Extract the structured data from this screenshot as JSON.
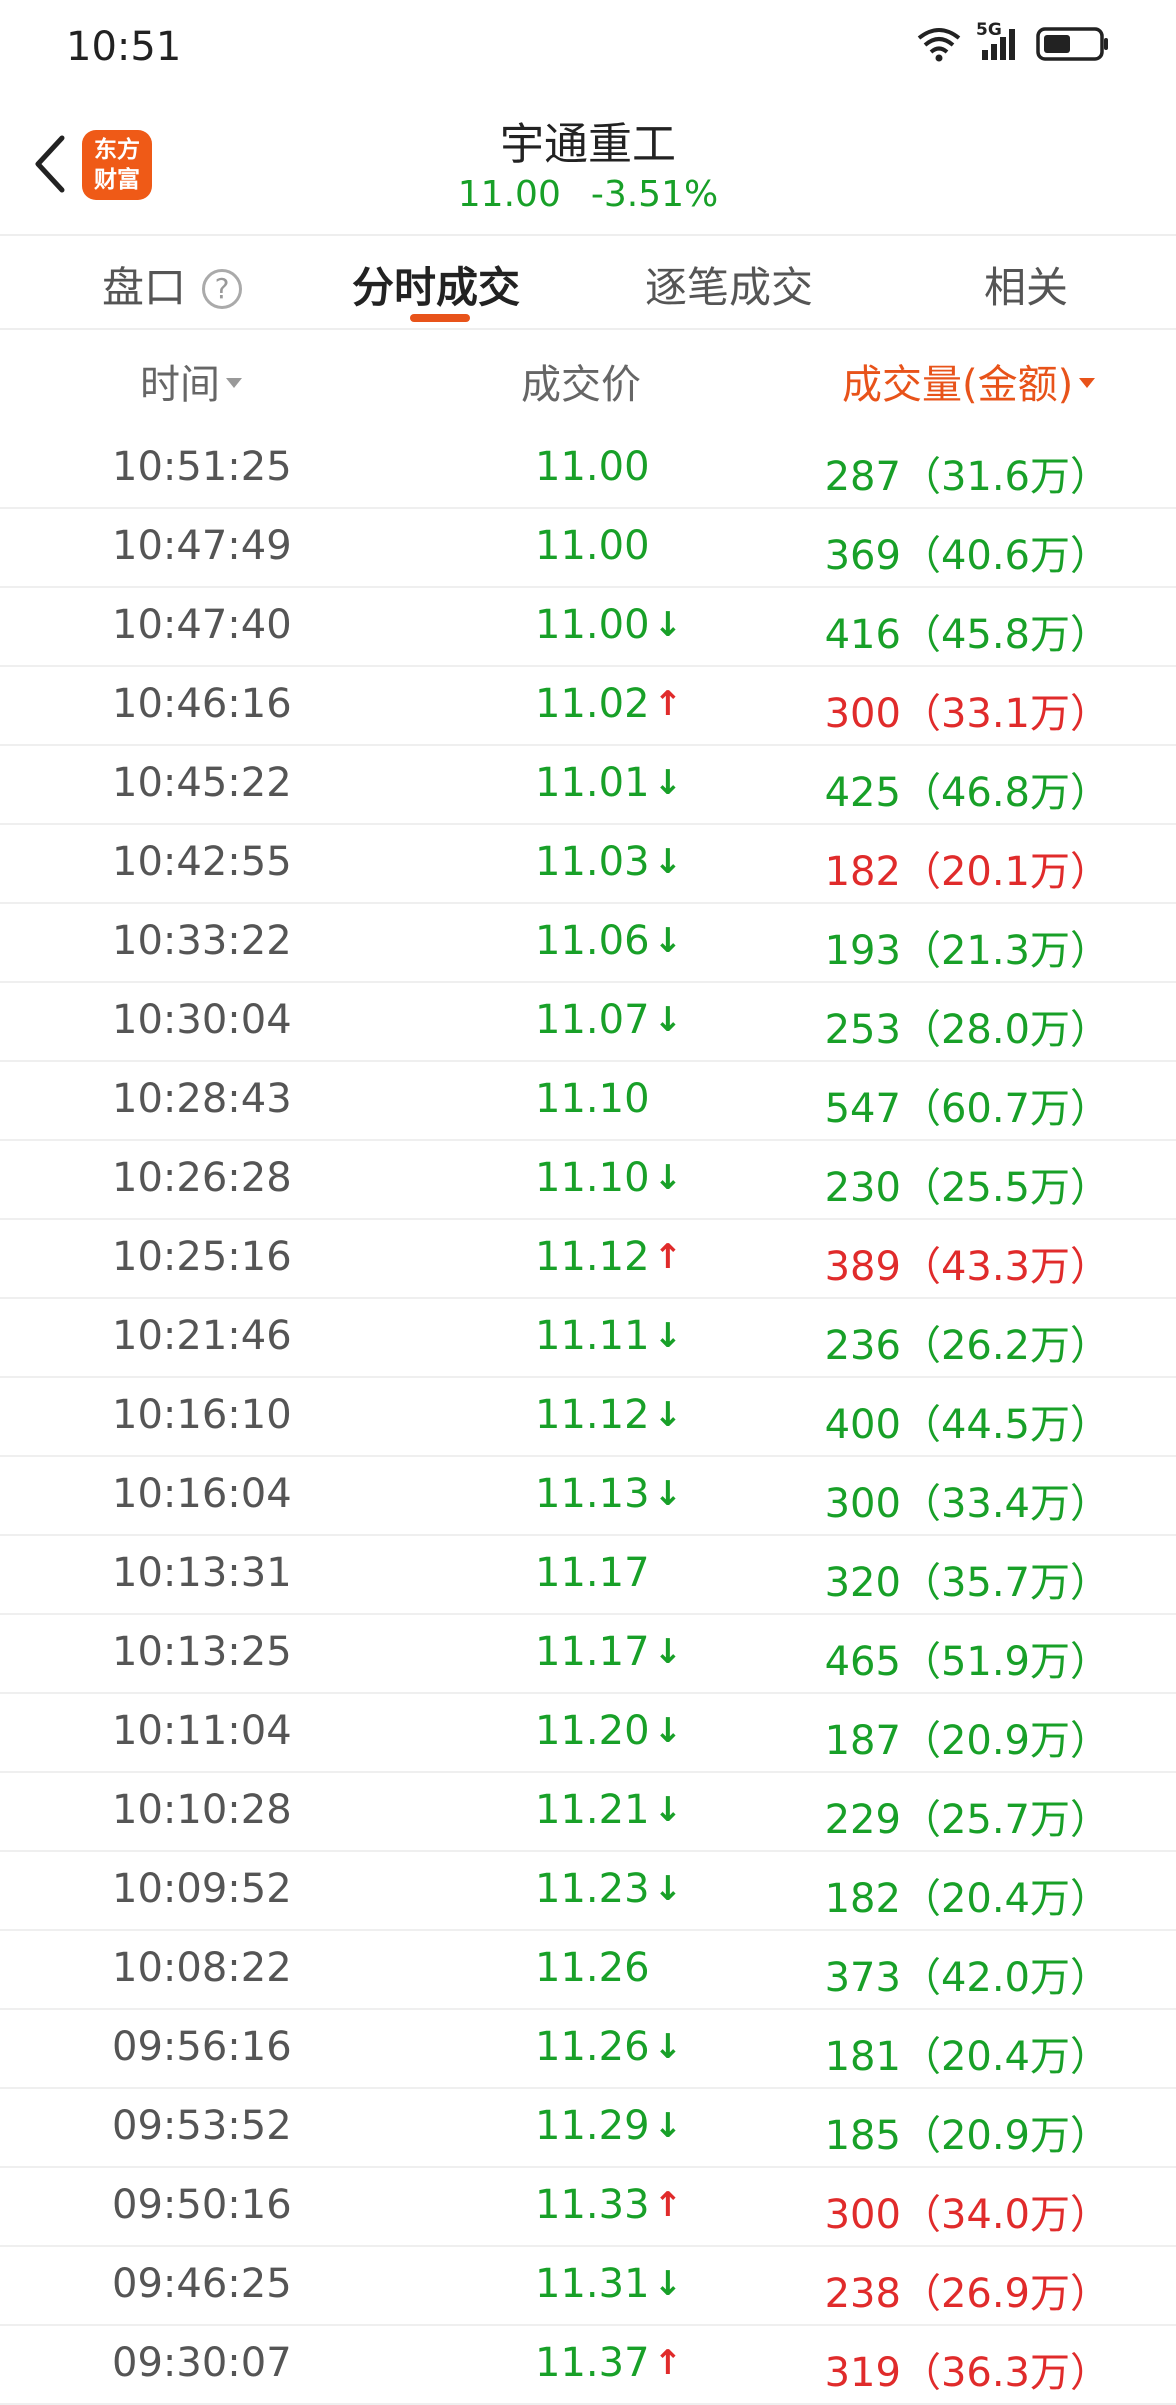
{
  "status_bar": {
    "time": "10:51",
    "network": "5G"
  },
  "header": {
    "logo_text_1": "东方",
    "logo_text_2": "财富",
    "stock_name": "宇通重工",
    "price": "11.00",
    "change_pct": "-3.51%"
  },
  "tabs": [
    {
      "label": "盘口",
      "active": false
    },
    {
      "label": "分时成交",
      "active": true
    },
    {
      "label": "逐笔成交",
      "active": false
    },
    {
      "label": "相关",
      "active": false
    }
  ],
  "help_glyph": "?",
  "columns": {
    "time": "时间",
    "price": "成交价",
    "volume": "成交量(金额)"
  },
  "colors": {
    "up": "#e02b2b",
    "down": "#18a028",
    "accent": "#e8531a"
  },
  "rows": [
    {
      "time": "10:51:25",
      "price": "11.00",
      "dir": "",
      "vol": "287",
      "amt": "31.6万",
      "color": "green"
    },
    {
      "time": "10:47:49",
      "price": "11.00",
      "dir": "",
      "vol": "369",
      "amt": "40.6万",
      "color": "green"
    },
    {
      "time": "10:47:40",
      "price": "11.00",
      "dir": "down",
      "vol": "416",
      "amt": "45.8万",
      "color": "green"
    },
    {
      "time": "10:46:16",
      "price": "11.02",
      "dir": "up",
      "vol": "300",
      "amt": "33.1万",
      "color": "red"
    },
    {
      "time": "10:45:22",
      "price": "11.01",
      "dir": "down",
      "vol": "425",
      "amt": "46.8万",
      "color": "green"
    },
    {
      "time": "10:42:55",
      "price": "11.03",
      "dir": "down",
      "vol": "182",
      "amt": "20.1万",
      "color": "red"
    },
    {
      "time": "10:33:22",
      "price": "11.06",
      "dir": "down",
      "vol": "193",
      "amt": "21.3万",
      "color": "green"
    },
    {
      "time": "10:30:04",
      "price": "11.07",
      "dir": "down",
      "vol": "253",
      "amt": "28.0万",
      "color": "green"
    },
    {
      "time": "10:28:43",
      "price": "11.10",
      "dir": "",
      "vol": "547",
      "amt": "60.7万",
      "color": "green"
    },
    {
      "time": "10:26:28",
      "price": "11.10",
      "dir": "down",
      "vol": "230",
      "amt": "25.5万",
      "color": "green"
    },
    {
      "time": "10:25:16",
      "price": "11.12",
      "dir": "up",
      "vol": "389",
      "amt": "43.3万",
      "color": "red"
    },
    {
      "time": "10:21:46",
      "price": "11.11",
      "dir": "down",
      "vol": "236",
      "amt": "26.2万",
      "color": "green"
    },
    {
      "time": "10:16:10",
      "price": "11.12",
      "dir": "down",
      "vol": "400",
      "amt": "44.5万",
      "color": "green"
    },
    {
      "time": "10:16:04",
      "price": "11.13",
      "dir": "down",
      "vol": "300",
      "amt": "33.4万",
      "color": "green"
    },
    {
      "time": "10:13:31",
      "price": "11.17",
      "dir": "",
      "vol": "320",
      "amt": "35.7万",
      "color": "green"
    },
    {
      "time": "10:13:25",
      "price": "11.17",
      "dir": "down",
      "vol": "465",
      "amt": "51.9万",
      "color": "green"
    },
    {
      "time": "10:11:04",
      "price": "11.20",
      "dir": "down",
      "vol": "187",
      "amt": "20.9万",
      "color": "green"
    },
    {
      "time": "10:10:28",
      "price": "11.21",
      "dir": "down",
      "vol": "229",
      "amt": "25.7万",
      "color": "green"
    },
    {
      "time": "10:09:52",
      "price": "11.23",
      "dir": "down",
      "vol": "182",
      "amt": "20.4万",
      "color": "green"
    },
    {
      "time": "10:08:22",
      "price": "11.26",
      "dir": "",
      "vol": "373",
      "amt": "42.0万",
      "color": "green"
    },
    {
      "time": "09:56:16",
      "price": "11.26",
      "dir": "down",
      "vol": "181",
      "amt": "20.4万",
      "color": "green"
    },
    {
      "time": "09:53:52",
      "price": "11.29",
      "dir": "down",
      "vol": "185",
      "amt": "20.9万",
      "color": "green"
    },
    {
      "time": "09:50:16",
      "price": "11.33",
      "dir": "up",
      "vol": "300",
      "amt": "34.0万",
      "color": "red"
    },
    {
      "time": "09:46:25",
      "price": "11.31",
      "dir": "down",
      "vol": "238",
      "amt": "26.9万",
      "color": "red"
    },
    {
      "time": "09:30:07",
      "price": "11.37",
      "dir": "up",
      "vol": "319",
      "amt": "36.3万",
      "color": "red"
    }
  ]
}
